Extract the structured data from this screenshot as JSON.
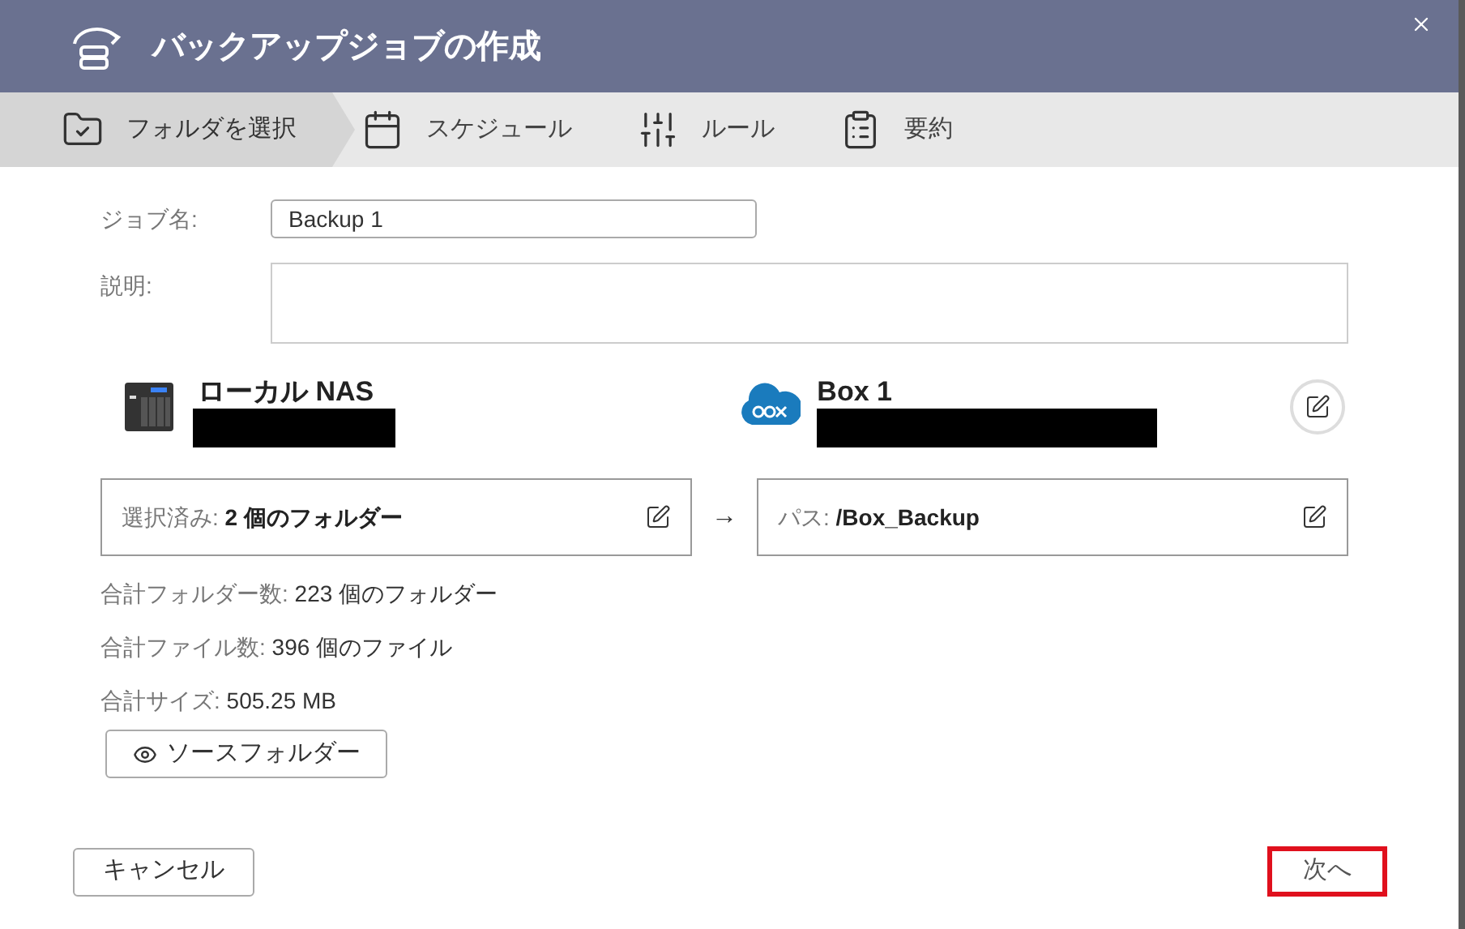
{
  "window": {
    "title": "バックアップジョブの作成"
  },
  "steps": [
    {
      "label": "フォルダを選択",
      "selected": true,
      "kind": "folder"
    },
    {
      "label": "スケジュール",
      "selected": false,
      "kind": "calendar"
    },
    {
      "label": "ルール",
      "selected": false,
      "kind": "sliders"
    },
    {
      "label": "要約",
      "selected": false,
      "kind": "clipboard"
    }
  ],
  "job_name": {
    "label": "ジョブ名:",
    "value": "Backup 1"
  },
  "description": {
    "label": "説明:"
  },
  "source": {
    "title": "ローカル NAS",
    "selection_label": "選択済み:",
    "selection_value": "2 個のフォルダー"
  },
  "arrow": "→",
  "destination": {
    "title": "Box 1",
    "path_label": "パス:",
    "path_value": "/Box_Backup"
  },
  "stats": [
    {
      "label": "合計フォルダー数:",
      "value": "223 個のフォルダー"
    },
    {
      "label": "合計ファイル数:",
      "value": "396 個のファイル"
    },
    {
      "label": "合計サイズ:",
      "value": "505.25 MB"
    }
  ],
  "source_button": "ソースフォルダー",
  "footer": {
    "cancel": "キャンセル",
    "next": "次へ",
    "next_highlighted": true
  }
}
